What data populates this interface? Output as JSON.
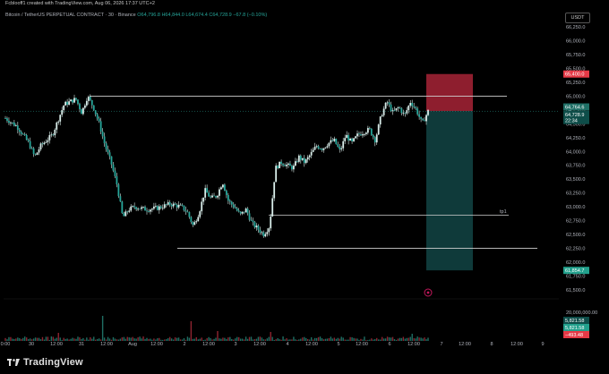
{
  "top_bar": {
    "text": "Fcblooff1 created with TradingView.com, Aug 06, 2026 17:37 UTC+2"
  },
  "header": {
    "symbol": "Bitcoin / TetherUS PERPETUAL CONTRACT · 30 · Binance",
    "ohlc": "O64,796.8  H64,844.0  L64,674.4  C64,728.9  −67.8 (−0.10%)"
  },
  "currency": "USDT",
  "brand": "TradingView",
  "colors": {
    "background": "#000000",
    "candle": "#d8ece9",
    "candle_accent": "#26a69a",
    "stop_zone": "#8e1e2e",
    "target_zone": "#0f3a3a",
    "level_line": "#d0d0d0",
    "sell_tag": "#e53946",
    "buy_tag": "#22a08c"
  },
  "chart_data": {
    "type": "candlestick",
    "x_ticks": [
      "0:00",
      "30",
      "12:00",
      "31",
      "12:00",
      "Aug",
      "12:00",
      "2",
      "12:00",
      "3",
      "12:00",
      "4",
      "12:00",
      "5",
      "12:00",
      "6",
      "12:00",
      "7",
      "12:00",
      "8",
      "12:00",
      "9"
    ],
    "y_ticks": [
      "66,250.0",
      "66,000.0",
      "65,750.0",
      "65,500.0",
      "65,250.0",
      "65,000.0",
      "64,750.0",
      "64,500.0",
      "64,250.0",
      "64,000.0",
      "63,750.0",
      "63,500.0",
      "63,250.0",
      "63,000.0",
      "62,750.0",
      "62,500.0",
      "62,250.0",
      "62,000.0",
      "61,750.0",
      "61,500.0"
    ],
    "ylim": [
      61400,
      66350
    ],
    "close_path": [
      [
        0,
        64600
      ],
      [
        2,
        64450
      ],
      [
        4,
        64150
      ],
      [
        5,
        63900
      ],
      [
        6,
        64100
      ],
      [
        8,
        64300
      ],
      [
        10,
        64850
      ],
      [
        12,
        64950
      ],
      [
        13,
        64700
      ],
      [
        14,
        65000
      ],
      [
        15,
        64800
      ],
      [
        16,
        64500
      ],
      [
        17,
        64100
      ],
      [
        18,
        63800
      ],
      [
        19,
        63400
      ],
      [
        20,
        62800
      ],
      [
        21,
        62950
      ],
      [
        22,
        63000
      ],
      [
        24,
        62950
      ],
      [
        26,
        62980
      ],
      [
        28,
        63050
      ],
      [
        30,
        63000
      ],
      [
        31,
        62900
      ],
      [
        32,
        62650
      ],
      [
        33,
        62900
      ],
      [
        34,
        63300
      ],
      [
        35,
        63150
      ],
      [
        36,
        63200
      ],
      [
        37,
        63450
      ],
      [
        38,
        63100
      ],
      [
        39,
        63000
      ],
      [
        40,
        62850
      ],
      [
        41,
        62950
      ],
      [
        42,
        62700
      ],
      [
        43,
        62600
      ],
      [
        44,
        62500
      ],
      [
        45,
        62650
      ],
      [
        46,
        63700
      ],
      [
        47,
        63800
      ],
      [
        48,
        63750
      ],
      [
        49,
        63700
      ],
      [
        50,
        63900
      ],
      [
        51,
        63800
      ],
      [
        52,
        63950
      ],
      [
        53,
        64100
      ],
      [
        54,
        64050
      ],
      [
        55,
        64150
      ],
      [
        56,
        64200
      ],
      [
        57,
        64000
      ],
      [
        58,
        64300
      ],
      [
        59,
        64150
      ],
      [
        60,
        64300
      ],
      [
        62,
        64400
      ],
      [
        63,
        64200
      ],
      [
        64,
        64650
      ],
      [
        65,
        64900
      ],
      [
        66,
        64700
      ],
      [
        67,
        64800
      ],
      [
        68,
        64650
      ],
      [
        69,
        64900
      ],
      [
        70,
        64750
      ],
      [
        71,
        64500
      ],
      [
        72,
        64728.9
      ]
    ],
    "volume_axis_label": "20,000,000.00",
    "volume_tags": [
      "5,821.58",
      "5,821.58",
      "−493.48"
    ],
    "levels": [
      {
        "name": "resistance",
        "y": 65000
      },
      {
        "name": "tp1",
        "y": 62850,
        "label": "tp1"
      },
      {
        "name": "support",
        "y": 62250
      }
    ],
    "position": {
      "type": "short",
      "entry": 64728.9,
      "stop": 65400,
      "target": 61850,
      "stop_label": "65,400.0",
      "current_label": "64,764.6",
      "entry_label": "64,728.9",
      "countdown_label": "22:34",
      "target_label": "61,854.7"
    }
  }
}
